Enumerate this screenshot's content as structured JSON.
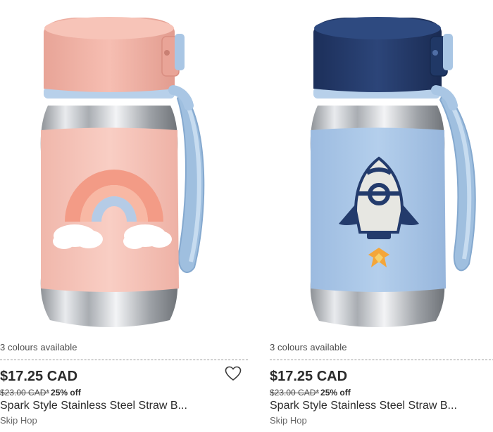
{
  "products": [
    {
      "colours_available": "3 colours available",
      "price": "$17.25 CAD",
      "original_price": "$23.00 CAD*",
      "discount": "25% off",
      "name": "Spark Style Stainless Steel Straw B...",
      "brand": "Skip Hop",
      "lid_color": "#f2b5a8",
      "sleeve_color": "#f7c9bf",
      "design": "rainbow",
      "wishlist_icon": "heart-outline-icon"
    },
    {
      "colours_available": "3 colours available",
      "price": "$17.25 CAD",
      "original_price": "$23.00 CAD*",
      "discount": "25% off",
      "name": "Spark Style Stainless Steel Straw B...",
      "brand": "Skip Hop",
      "lid_color": "#243a6b",
      "sleeve_color": "#a9c6e8",
      "design": "rocket"
    }
  ],
  "colors": {
    "strap": "#a9c6e4",
    "steel": "#c9ccd0",
    "text": "#2b2b2b"
  }
}
